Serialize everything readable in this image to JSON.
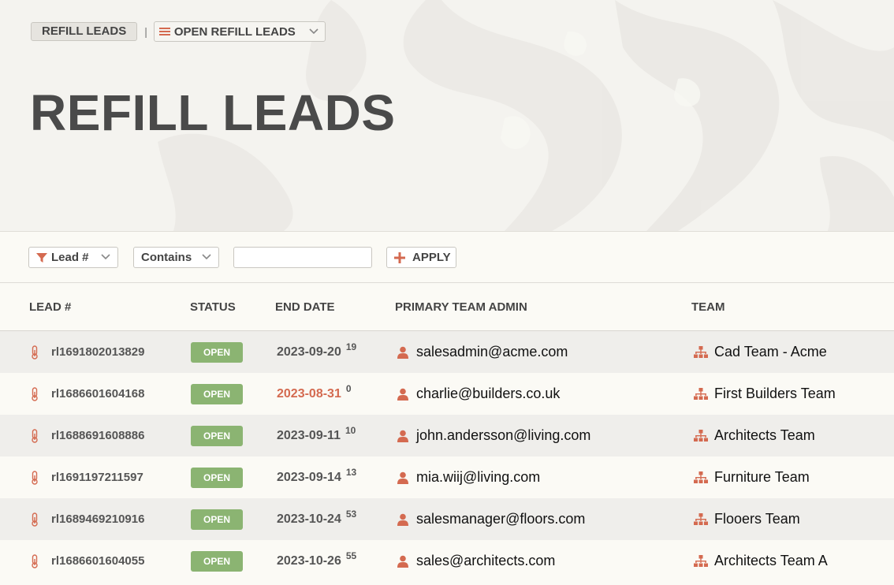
{
  "breadcrumb": {
    "root_label": "REFILL LEADS",
    "separator": "|",
    "view_label": "OPEN REFILL LEADS"
  },
  "page": {
    "title": "REFILL LEADS"
  },
  "filter": {
    "field": "Lead #",
    "operator": "Contains",
    "value": "",
    "apply_label": "APPLY"
  },
  "table": {
    "columns": [
      "LEAD #",
      "STATUS",
      "END DATE",
      "PRIMARY TEAM ADMIN",
      "TEAM"
    ],
    "rows": [
      {
        "lead": "rl1691802013829",
        "status": "OPEN",
        "end_date": "2023-09-20",
        "days": "19",
        "admin": "salesadmin@acme.com",
        "team": "Cad Team - Acme",
        "warn": false
      },
      {
        "lead": "rl1686601604168",
        "status": "OPEN",
        "end_date": "2023-08-31",
        "days": "0",
        "admin": "charlie@builders.co.uk",
        "team": "First Builders Team",
        "warn": true
      },
      {
        "lead": "rl1688691608886",
        "status": "OPEN",
        "end_date": "2023-09-11",
        "days": "10",
        "admin": "john.andersson@living.com",
        "team": "Architects Team",
        "warn": false
      },
      {
        "lead": "rl1691197211597",
        "status": "OPEN",
        "end_date": "2023-09-14",
        "days": "13",
        "admin": "mia.wiij@living.com",
        "team": "Furniture Team",
        "warn": false
      },
      {
        "lead": "rl1689469210916",
        "status": "OPEN",
        "end_date": "2023-10-24",
        "days": "53",
        "admin": "salesmanager@floors.com",
        "team": "Flooers Team",
        "warn": false
      },
      {
        "lead": "rl1686601604055",
        "status": "OPEN",
        "end_date": "2023-10-26",
        "days": "55",
        "admin": "sales@architects.com",
        "team": "Architects Team A",
        "warn": false
      }
    ]
  },
  "colors": {
    "accent": "#d46a50",
    "open_badge": "#8bb472",
    "text": "#444444"
  },
  "icons": {
    "filter": "funnel-icon",
    "menu": "hamburger-icon",
    "chevron": "chevron-down-icon",
    "add": "plus-icon",
    "lead": "thermometer-icon",
    "admin": "user-icon",
    "team": "org-chart-icon"
  }
}
